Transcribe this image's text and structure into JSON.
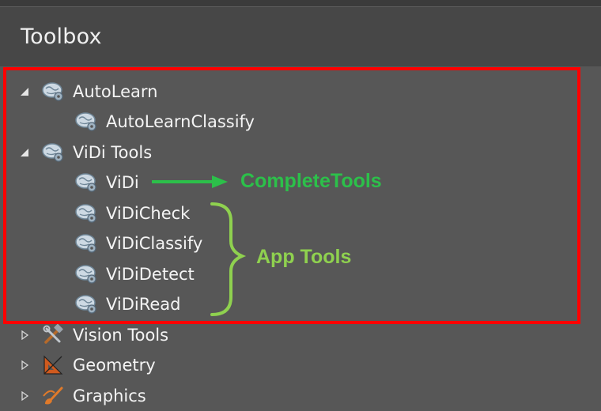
{
  "toolbox": {
    "title": "Toolbox"
  },
  "tree": {
    "autolearn": {
      "label": "AutoLearn",
      "children": [
        "AutoLearnClassify"
      ]
    },
    "vidi_tools": {
      "label": "ViDi Tools",
      "children": [
        "ViDi",
        "ViDiCheck",
        "ViDiClassify",
        "ViDiDetect",
        "ViDiRead"
      ]
    },
    "collapsed": [
      "Vision Tools",
      "Geometry",
      "Graphics"
    ]
  },
  "annotations": {
    "complete_tools": "CompleteTools",
    "app_tools": "App Tools"
  },
  "colors": {
    "highlight_box": "#ff0000",
    "complete_tools": "#2cc04a",
    "app_tools": "#8fd14f"
  }
}
